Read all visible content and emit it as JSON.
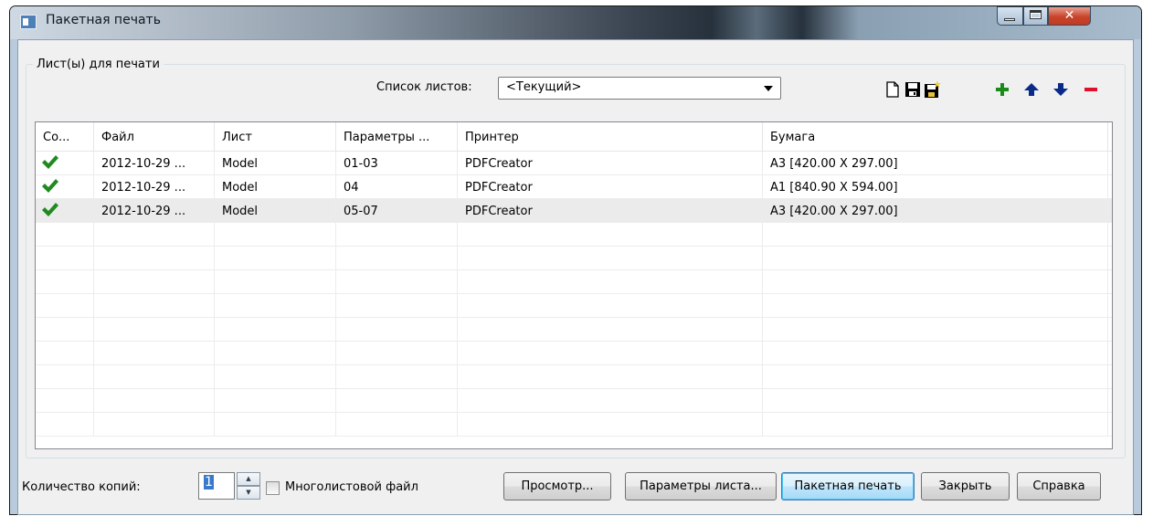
{
  "window": {
    "title": "Пакетная печать"
  },
  "group": {
    "label": "Лист(ы) для печати",
    "sheets_label": "Список листов:",
    "sheets_value": "<Текущий>"
  },
  "toolbar": {
    "icons": [
      "new-file-icon",
      "save-icon",
      "save-as-icon",
      "add-icon",
      "move-up-icon",
      "move-down-icon",
      "remove-icon"
    ],
    "colors": {
      "add": "#1a8a1a",
      "arrows": "#0a2a8a",
      "remove": "#e0102a"
    }
  },
  "table": {
    "columns": [
      "Со...",
      "Файл",
      "Лист",
      "Параметры ...",
      "Принтер",
      "Бумага"
    ],
    "rows": [
      {
        "status": "check",
        "file": "2012-10-29 ...",
        "sheet": "Model",
        "params": "01-03",
        "printer": "PDFCreator",
        "paper": "A3 [420.00 X 297.00]"
      },
      {
        "status": "check",
        "file": "2012-10-29 ...",
        "sheet": "Model",
        "params": "04",
        "printer": "PDFCreator",
        "paper": "A1 [840.90 X 594.00]"
      },
      {
        "status": "check",
        "file": "2012-10-29 ...",
        "sheet": "Model",
        "params": "05-07",
        "printer": "PDFCreator",
        "paper": "A3 [420.00 X 297.00]"
      }
    ],
    "selected_row": 3,
    "check_color": "#1f8a1f"
  },
  "bottom": {
    "copies_label": "Количество копий:",
    "copies_value": "1",
    "multi_label": "Многолистовой файл",
    "multi_checked": false,
    "buttons": {
      "preview": "Просмотр...",
      "sheet_params": "Параметры листа...",
      "batch_print": "Пакетная печать",
      "close": "Закрыть",
      "help": "Справка"
    }
  }
}
